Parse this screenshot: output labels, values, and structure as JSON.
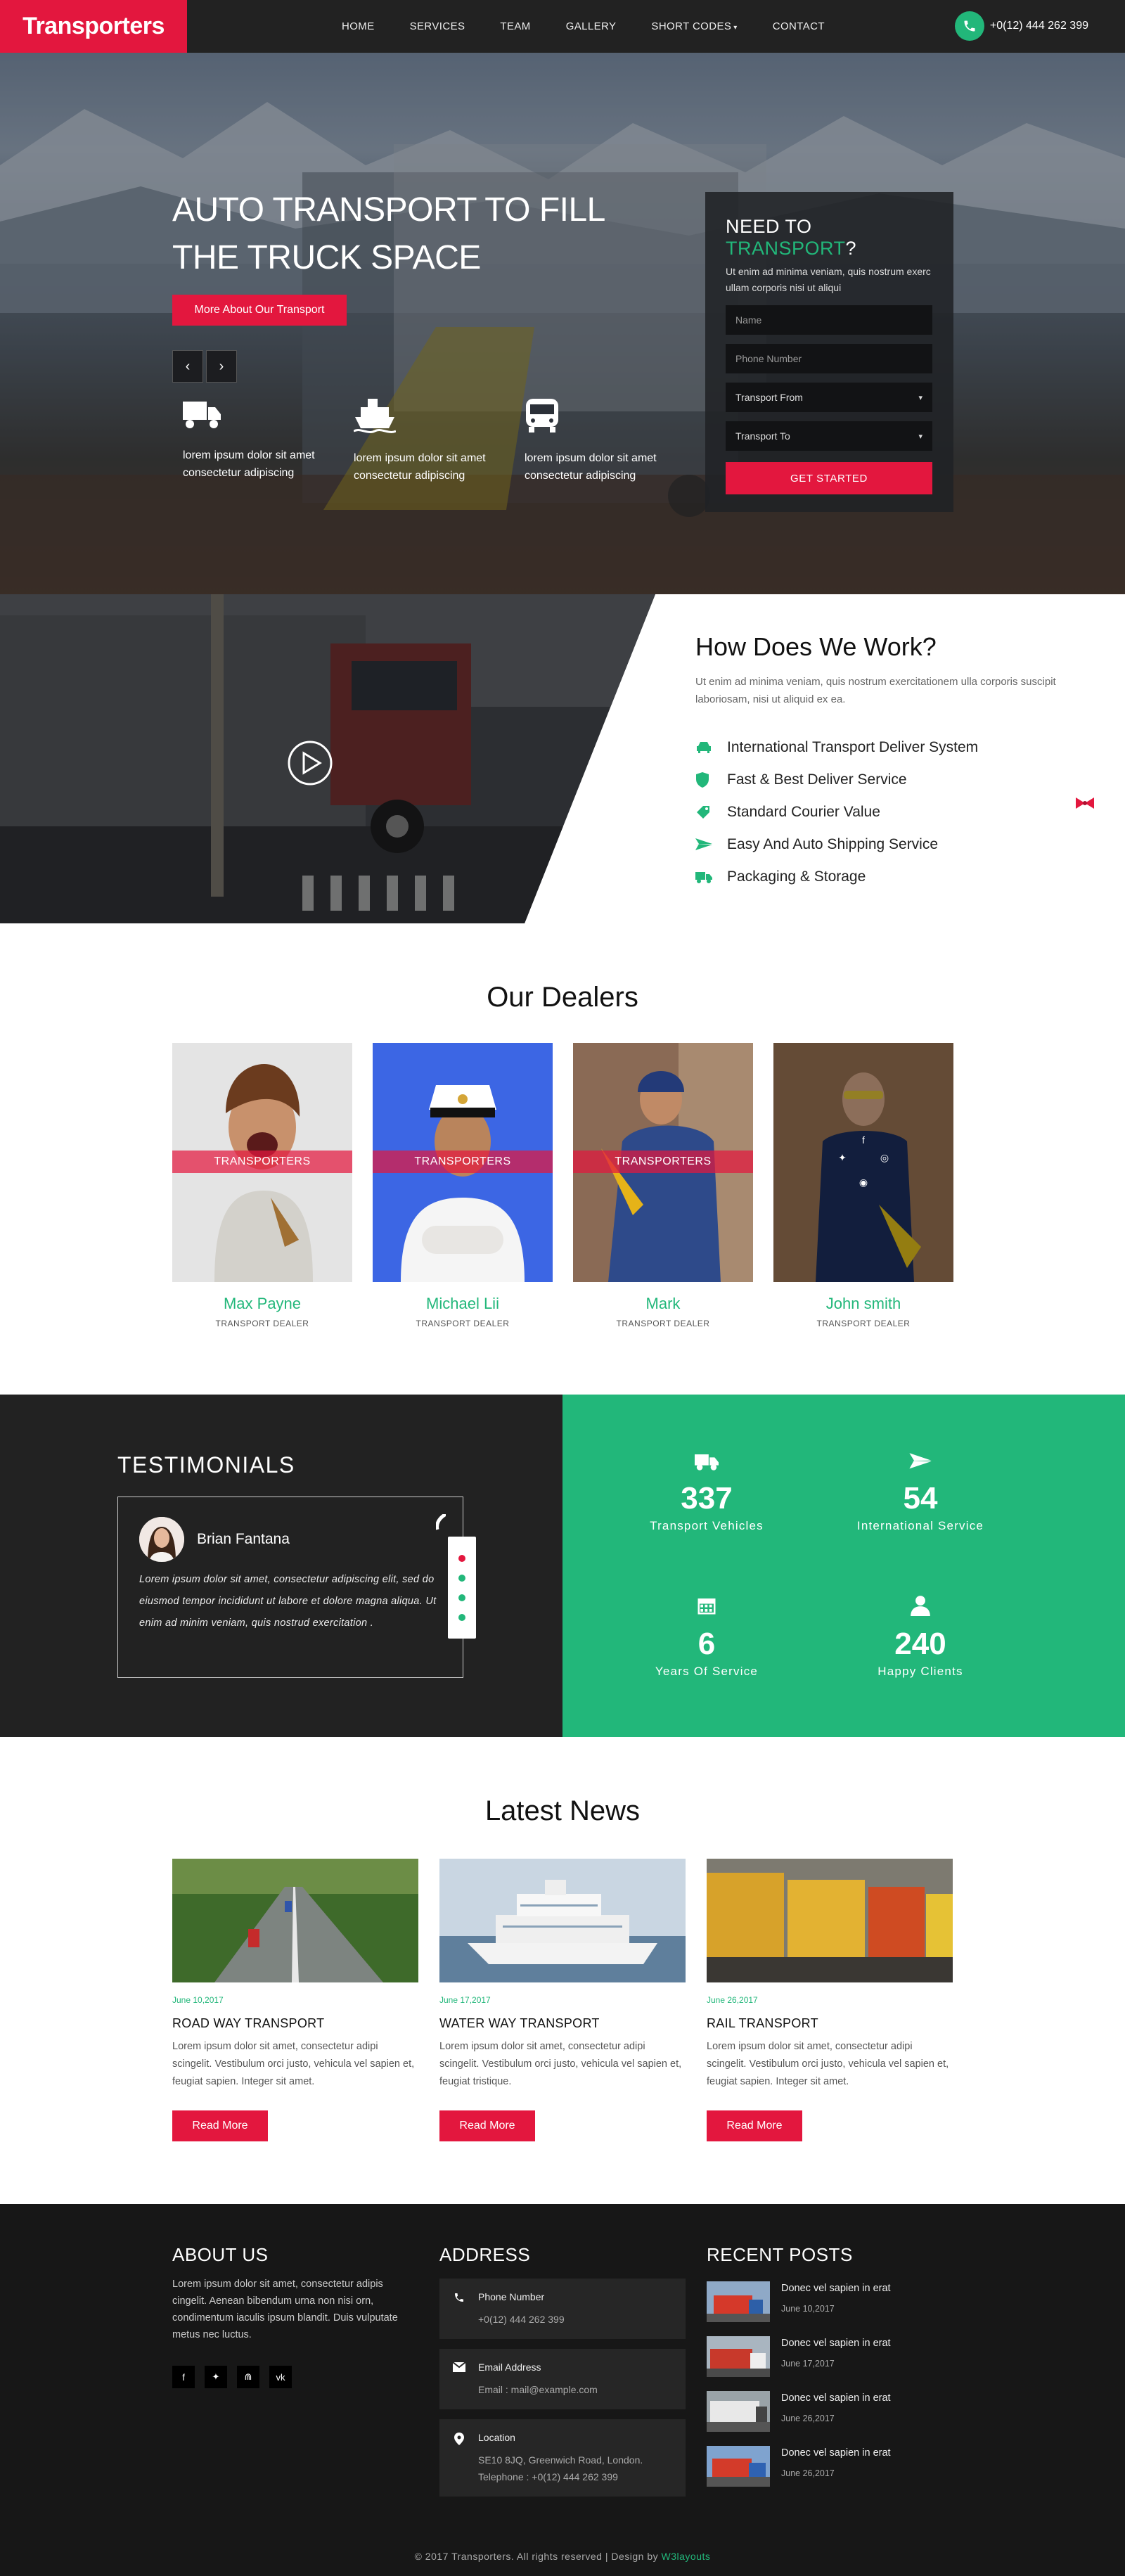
{
  "colors": {
    "accent": "#e3173e",
    "green": "#22b77a",
    "dark": "#222222"
  },
  "nav": {
    "logo": "Transporters",
    "items": [
      "HOME",
      "SERVICES",
      "TEAM",
      "GALLERY",
      "SHORT CODES",
      "CONTACT"
    ],
    "phone": "+0(12) 444 262 399"
  },
  "hero": {
    "title": "AUTO TRANSPORT TO FILL THE TRUCK SPACE",
    "cta": "More About Our Transport",
    "features": [
      {
        "icon": "truck-icon",
        "text": "lorem ipsum dolor sit amet consectetur adipiscing"
      },
      {
        "icon": "ship-icon",
        "text": "lorem ipsum dolor sit amet consectetur adipiscing"
      },
      {
        "icon": "bus-icon",
        "text": "lorem ipsum dolor sit amet consectetur adipiscing"
      }
    ],
    "form": {
      "title_a": "NEED TO ",
      "title_b": "TRANSPORT",
      "title_c": "?",
      "text": "Ut enim ad minima veniam, quis nostrum exerc ullam corporis nisi ut aliqui",
      "name_ph": "Name",
      "phone_ph": "Phone Number",
      "from": "Transport From",
      "to": "Transport To",
      "submit": "GET STARTED"
    }
  },
  "how": {
    "title": "How Does We Work?",
    "intro": "Ut enim ad minima veniam, quis nostrum exercitationem ulla corporis suscipit laboriosam, nisi ut aliquid ex ea.",
    "items": [
      "International Transport Deliver System",
      "Fast & Best Deliver Service",
      "Standard Courier Value",
      "Easy And Auto Shipping Service",
      "Packaging & Storage"
    ]
  },
  "dealers": {
    "title": "Our Dealers",
    "ribbon": "TRANSPORTERS",
    "people": [
      {
        "name": "Max Payne",
        "role": "TRANSPORT DEALER"
      },
      {
        "name": "Michael Lii",
        "role": "TRANSPORT DEALER"
      },
      {
        "name": "Mark",
        "role": "TRANSPORT DEALER"
      },
      {
        "name": "John smith",
        "role": "TRANSPORT DEALER"
      }
    ]
  },
  "testimonials": {
    "title": "TESTIMONIALS",
    "name": "Brian Fantana",
    "quote": "Lorem ipsum dolor sit amet, consectetur adipiscing elit, sed do eiusmod tempor incididunt ut labore et dolore magna aliqua. Ut enim ad minim veniam, quis nostrud exercitation ."
  },
  "stats": [
    {
      "icon": "truck-icon",
      "value": "337",
      "label": "Transport Vehicles"
    },
    {
      "icon": "plane-icon",
      "value": "54",
      "label": "International Service"
    },
    {
      "icon": "calendar-icon",
      "value": "6",
      "label": "Years Of Service"
    },
    {
      "icon": "user-icon",
      "value": "240",
      "label": "Happy Clients"
    }
  ],
  "news": {
    "title": "Latest News",
    "read_more": "Read More",
    "posts": [
      {
        "date": "June 10,2017",
        "title": "ROAD WAY TRANSPORT",
        "text": "Lorem ipsum dolor sit amet, consectetur adipi scingelit. Vestibulum orci justo, vehicula vel sapien et, feugiat sapien. Integer sit amet."
      },
      {
        "date": "June 17,2017",
        "title": "WATER WAY TRANSPORT",
        "text": "Lorem ipsum dolor sit amet, consectetur adipi scingelit. Vestibulum orci justo, vehicula vel sapien et, feugiat tristique."
      },
      {
        "date": "June 26,2017",
        "title": "RAIL TRANSPORT",
        "text": "Lorem ipsum dolor sit amet, consectetur adipi scingelit. Vestibulum orci justo, vehicula vel sapien et, feugiat sapien. Integer sit amet."
      }
    ]
  },
  "footer": {
    "about_title": "ABOUT US",
    "about_text": "Lorem ipsum dolor sit amet, consectetur adipis cingelit. Aenean bibendum urna non nisi orn, condimentum iaculis ipsum blandit. Duis vulputate metus nec luctus.",
    "social": [
      "f",
      "t",
      "rss",
      "vk"
    ],
    "address_title": "ADDRESS",
    "address": [
      {
        "label": "Phone Number",
        "value": "+0(12) 444 262 399"
      },
      {
        "label": "Email Address",
        "value": "Email : mail@example.com"
      },
      {
        "label": "Location",
        "value": "SE10 8JQ, Greenwich Road, London.",
        "value2": "Telephone : +0(12) 444 262 399"
      }
    ],
    "recent_title": "RECENT POSTS",
    "recent": [
      {
        "title": "Donec vel sapien in erat",
        "date": "June 10,2017"
      },
      {
        "title": "Donec vel sapien in erat",
        "date": "June 17,2017"
      },
      {
        "title": "Donec vel sapien in erat",
        "date": "June 26,2017"
      },
      {
        "title": "Donec vel sapien in erat",
        "date": "June 26,2017"
      }
    ],
    "copyright": "© 2017 Transporters. All rights reserved | Design by ",
    "designer": "W3layouts"
  }
}
